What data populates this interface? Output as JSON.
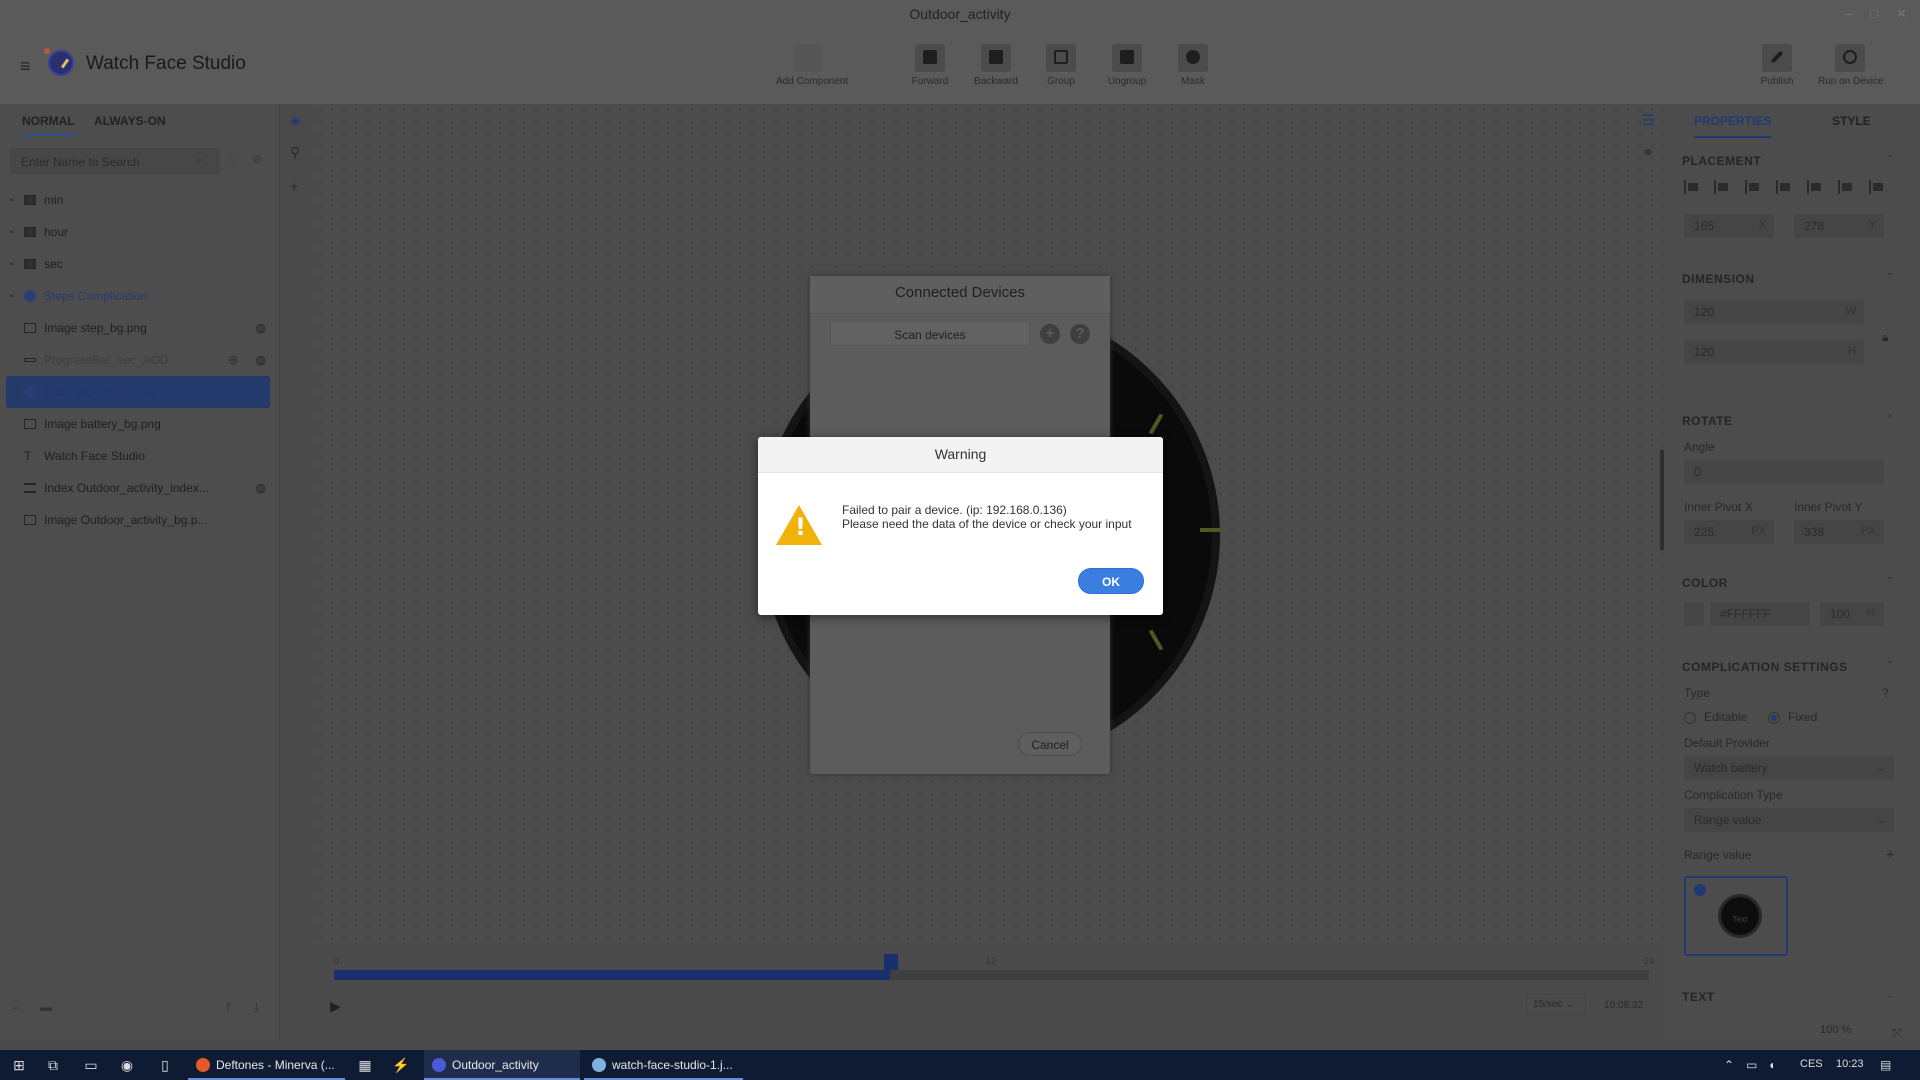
{
  "window": {
    "title": "Outdoor_activity",
    "app_name": "Watch Face Studio",
    "controls": [
      "–",
      "□",
      "✕"
    ]
  },
  "toolbar": {
    "add_component": "Add Component",
    "forward": "Forward",
    "backward": "Backward",
    "group": "Group",
    "ungroup": "Ungroup",
    "mask": "Mask",
    "publish": "Publish",
    "run_on_device": "Run on Device"
  },
  "left_panel": {
    "tabs": [
      "NORMAL",
      "ALWAYS-ON"
    ],
    "search_placeholder": "Enter Name to Search",
    "layers": [
      {
        "name": "min",
        "kind": "folder"
      },
      {
        "name": "hour",
        "kind": "folder"
      },
      {
        "name": "sec",
        "kind": "folder"
      },
      {
        "name": "Steps Complication",
        "kind": "complication"
      },
      {
        "name": "Image step_bg.png",
        "kind": "image"
      },
      {
        "name": "ProgressBar_sec_AOD",
        "kind": "progress"
      },
      {
        "name": "Battery Complication",
        "kind": "complication",
        "selected": true
      },
      {
        "name": "Image battery_bg.png",
        "kind": "image"
      },
      {
        "name": "Watch Face Studio",
        "kind": "text"
      },
      {
        "name": "Index Outdoor_activity_index...",
        "kind": "index"
      },
      {
        "name": "Image Outdoor_activity_bg.p...",
        "kind": "image"
      }
    ]
  },
  "timeline": {
    "marks": [
      "0",
      "12",
      "24"
    ],
    "progress_fraction": 0.42,
    "rate": "15/sec",
    "time": "10:08:32"
  },
  "right_panel": {
    "tabs": [
      "PROPERTIES",
      "STYLE"
    ],
    "placement": {
      "header": "PLACEMENT",
      "x": "165",
      "x_unit": "X",
      "y": "278",
      "y_unit": "Y"
    },
    "dimension": {
      "header": "DIMENSION",
      "w": "120",
      "w_unit": "W",
      "h": "120",
      "h_unit": "H"
    },
    "rotate": {
      "header": "ROTATE",
      "angle_label": "Angle",
      "angle": "0",
      "pivot_x_label": "Inner Pivot X",
      "pivot_x": "225",
      "pivot_y_label": "Inner Pivot Y",
      "pivot_y": "338",
      "unit": "PX"
    },
    "color": {
      "header": "COLOR",
      "hex": "#FFFFFF",
      "opacity": "100",
      "opacity_unit": "%"
    },
    "complication": {
      "header": "COMPLICATION SETTINGS",
      "type_label": "Type",
      "editable": "Editable",
      "fixed": "Fixed",
      "provider_label": "Default Provider",
      "provider": "Watch battery",
      "ctype_label": "Complication Type",
      "ctype": "Range value",
      "range_label": "Range value",
      "thumb_text": "Text"
    },
    "text_header": "TEXT",
    "zoom": "100",
    "zoom_unit": "%"
  },
  "connected_dialog": {
    "title": "Connected Devices",
    "scan": "Scan devices",
    "cancel": "Cancel"
  },
  "warning": {
    "title": "Warning",
    "message_line1": "Failed to pair a device. (ip: 192.168.0.136)",
    "message_line2": "Please need the data of the device or check your input",
    "ok": "OK",
    "icon_color": "#f2b20c",
    "button_color": "#3a7fe0"
  },
  "taskbar": {
    "apps": [
      {
        "label": "Deftones - Minerva (...",
        "color": "#e05a2a"
      },
      {
        "label": "Outdoor_activity",
        "color": "#4a5ad8",
        "active": true
      },
      {
        "label": "watch-face-studio-1.j...",
        "color": "#7fb0e0"
      }
    ],
    "lang": "CES",
    "time": "10:23"
  }
}
